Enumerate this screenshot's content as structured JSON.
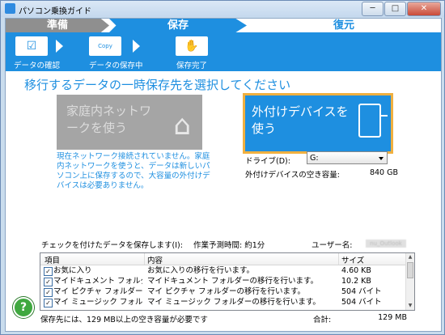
{
  "window": {
    "title": "パソコン乗換ガイド",
    "minimize": "─",
    "maximize": "□",
    "close": "✕"
  },
  "steps": {
    "step1": "準備",
    "step2": "保存",
    "step3": "復元",
    "sub1": "データの確認",
    "sub2": "データの保存中",
    "sub3": "保存完了",
    "sub2_icon_text": "Copy"
  },
  "heading": "移行するデータの一時保存先を選択してください",
  "options": {
    "home_network": "家庭内ネットワークを使う",
    "external_device": "外付けデバイスを使う",
    "network_desc": "現在ネットワーク接続されていません。家庭内ネットワークを使うと、データは新しいパソコン上に保存するので、大容量の外付けデバイスは必要ありません。"
  },
  "drive": {
    "label": "ドライブ(D):",
    "value": "G:",
    "free_label": "外付けデバイスの空き容量:",
    "free_value": "840 GB"
  },
  "save_info": {
    "label": "チェックを付けたデータを保存します(I):",
    "time": "作業予測時間: 約1分",
    "user_label": "ユーザー名:",
    "user_value": "nu_Outlook"
  },
  "list": {
    "columns": [
      "項目",
      "内容",
      "サイズ"
    ],
    "rows": [
      {
        "item": "お気に入り",
        "desc": "お気に入りの移行を行います。",
        "size": "4.60 KB"
      },
      {
        "item": "マイドキュメント フォルダー",
        "desc": "マイドキュメント フォルダーの移行を行います。",
        "size": "10.2 KB"
      },
      {
        "item": "マイ ピクチャ フォルダー",
        "desc": "マイ ピクチャ フォルダーの移行を行います。",
        "size": "504 バイト"
      },
      {
        "item": "マイ ミュージック フォルダー",
        "desc": "マイ ミュージック フォルダーの移行を行います。",
        "size": "504 バイト"
      }
    ]
  },
  "footer": {
    "need": "保存先には、129 MB以上の空き容量が必要です",
    "total_label": "合計:",
    "total_value": "129 MB",
    "help": "?"
  }
}
